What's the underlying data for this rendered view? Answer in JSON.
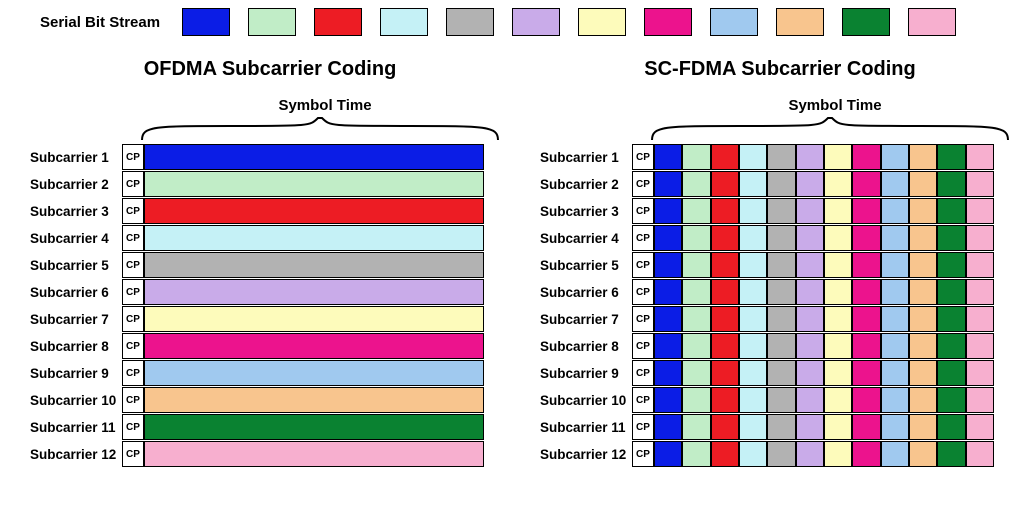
{
  "header": {
    "label": "Serial Bit Stream"
  },
  "colors": [
    "#0b1de6",
    "#c1edc7",
    "#ed1c24",
    "#c5f1f6",
    "#b2b2b2",
    "#c9abe9",
    "#fdfbbb",
    "#ec138d",
    "#a0c9ef",
    "#f8c58e",
    "#0a8231",
    "#f7afcf"
  ],
  "cp_text": "CP",
  "num_subcarriers": 12,
  "subcarrier_label_prefix": "Subcarrier ",
  "panels": {
    "ofdma": {
      "title": "OFDMA Subcarrier Coding",
      "symbol_time": "Symbol Time"
    },
    "scfdma": {
      "title": "SC-FDMA Subcarrier Coding",
      "symbol_time": "Symbol Time"
    }
  },
  "chart_data": {
    "type": "heatmap",
    "description": "Comparison of subcarrier data mapping: OFDMA assigns one bit-stream color per subcarrier for the whole symbol; SC-FDMA spreads all 12 bit-stream colors across each subcarrier within one symbol time.",
    "subcarriers": 12,
    "time_slots_per_symbol_scfdma": 12,
    "ofdma": {
      "rows": [
        0,
        1,
        2,
        3,
        4,
        5,
        6,
        7,
        8,
        9,
        10,
        11
      ]
    },
    "scfdma": {
      "row_pattern": [
        0,
        1,
        2,
        3,
        4,
        5,
        6,
        7,
        8,
        9,
        10,
        11
      ]
    }
  }
}
